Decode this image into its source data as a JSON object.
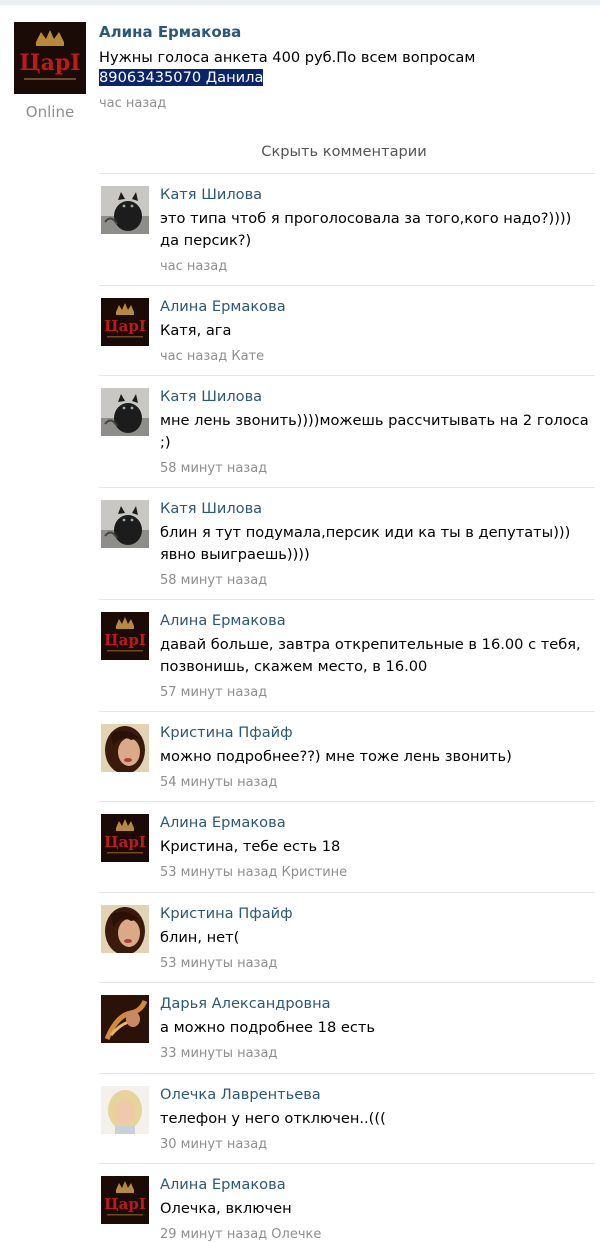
{
  "post": {
    "author": "Алина Ермакова",
    "text": "Нужны голоса анкета 400 руб.По всем вопросам",
    "text_highlight": "89063435070 Данила",
    "time": "час назад",
    "status": "Online",
    "avatar_logo": "ЦарI"
  },
  "hide_comments": "Скрыть комментарии",
  "comments": [
    {
      "author": "Катя Шилова",
      "text": "это типа чтоб я проголосовала за того,кого надо?)))) да персик?)",
      "time": "час назад",
      "avatar": "cat"
    },
    {
      "author": "Алина Ермакова",
      "text": "Катя, ага",
      "time": "час назад Кате",
      "avatar": "tsar"
    },
    {
      "author": "Катя Шилова",
      "text": "мне лень звонить))))можешь рассчитывать на 2 голоса ;)",
      "time": "58 минут назад",
      "avatar": "cat"
    },
    {
      "author": "Катя Шилова",
      "text": "блин я тут подумала,персик иди ка ты в депутаты))) явно выиграешь))))",
      "time": "58 минут назад",
      "avatar": "cat"
    },
    {
      "author": "Алина Ермакова",
      "text": "давай больше, завтра открепительные в 16.00 с тебя, позвонишь, скажем место, в 16.00",
      "time": "57 минут назад",
      "avatar": "tsar"
    },
    {
      "author": "Кристина Пфайф",
      "text": "можно подробнее??) мне тоже лень звонить)",
      "time": "54 минуты назад",
      "avatar": "kristina"
    },
    {
      "author": "Алина Ермакова",
      "text": "Кристина, тебе есть 18",
      "time": "53 минуты назад Кристине",
      "avatar": "tsar"
    },
    {
      "author": "Кристина Пфайф",
      "text": "блин, нет(",
      "time": "53 минуты назад",
      "avatar": "kristina"
    },
    {
      "author": "Дарья Александровна",
      "text": "а можно подробнее 18 есть",
      "time": "33 минуты назад",
      "avatar": "darya"
    },
    {
      "author": "Олечка Лаврентьева",
      "text": "телефон у него отключен..(((",
      "time": "30 минут назад",
      "avatar": "olechka"
    },
    {
      "author": "Алина Ермакова",
      "text": "Олечка, включен",
      "time": "29 минут назад Олечке",
      "avatar": "tsar"
    }
  ],
  "colors": {
    "link": "#2b587a",
    "muted": "#8e8e8e",
    "divider": "#e4e8ed",
    "highlight": "#0a246a"
  }
}
